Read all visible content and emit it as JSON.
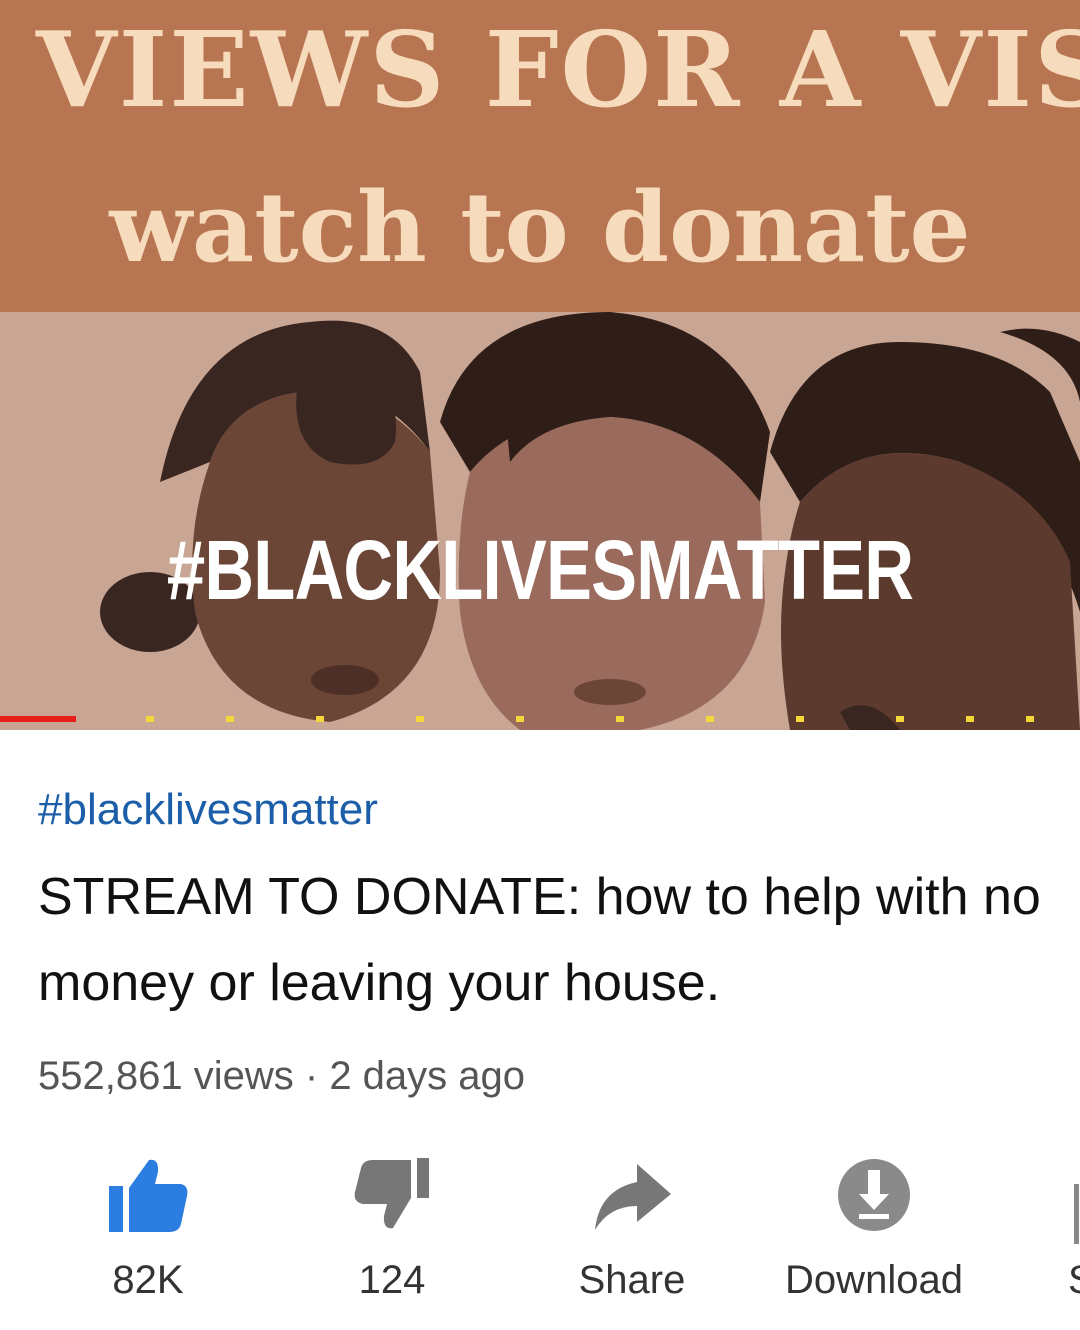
{
  "thumbnail": {
    "banner_line1": "VIEWS FOR A VISIO",
    "banner_line2": "watch to donate",
    "overlay_hashtag": "#BLACKLIVESMATTER"
  },
  "playback": {
    "progress_fraction": 0.07
  },
  "video": {
    "hashtag": "#blacklivesmatter",
    "title": "STREAM TO DONATE: how to help with no money or leaving your house.",
    "views": "552,861 views",
    "separator": "·",
    "age": "2 days ago"
  },
  "actions": {
    "like": {
      "label": "82K",
      "icon": "thumbs-up-icon",
      "active": true
    },
    "dislike": {
      "label": "124",
      "icon": "thumbs-down-icon"
    },
    "share": {
      "label": "Share",
      "icon": "share-arrow-icon"
    },
    "download": {
      "label": "Download",
      "icon": "download-icon"
    },
    "save_partial": {
      "label": "S",
      "icon": "save-icon"
    }
  },
  "colors": {
    "banner": "#b87552",
    "banner_text": "#f6dcbc",
    "link": "#1c5fa8",
    "like_active": "#2b7de1",
    "progress": "#e62117",
    "ad_marker": "#f4d83a"
  }
}
